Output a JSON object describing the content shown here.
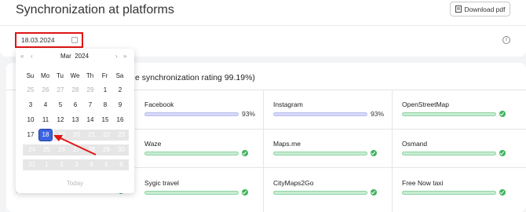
{
  "header": {
    "title": "Synchronization at platforms",
    "download_label": "Download pdf",
    "date_value": "18.03.2024"
  },
  "main": {
    "heading": "e synchronization rating 99.19%)"
  },
  "platforms": [
    {
      "name": "Facebook",
      "value": 93,
      "label": "93%",
      "color": "blue"
    },
    {
      "name": "Instagram",
      "value": 93,
      "label": "93%",
      "color": "blue"
    },
    {
      "name": "OpenStreetMap",
      "value": 100,
      "label": "",
      "color": "green"
    },
    {
      "name": "Waze",
      "value": 100,
      "label": "",
      "color": "green"
    },
    {
      "name": "Maps.me",
      "value": 100,
      "label": "",
      "color": "green"
    },
    {
      "name": "Osmand",
      "value": 100,
      "label": "",
      "color": "green"
    },
    {
      "name": "Sygic travel",
      "value": 100,
      "label": "",
      "color": "green"
    },
    {
      "name": "CityMaps2Go",
      "value": 100,
      "label": "",
      "color": "green"
    },
    {
      "name": "Free Now taxi",
      "value": 100,
      "label": "",
      "color": "green"
    }
  ],
  "calendar": {
    "month": "Mar",
    "year": "2024",
    "nav_prev_year": "«",
    "nav_prev": "‹",
    "nav_next": "›",
    "nav_next_year": "»",
    "weekdays": [
      "Su",
      "Mo",
      "Tu",
      "We",
      "Th",
      "Fr",
      "Sa"
    ],
    "weeks": [
      [
        "25",
        "26",
        "27",
        "28",
        "29",
        "1",
        "2"
      ],
      [
        "3",
        "4",
        "5",
        "6",
        "7",
        "8",
        "9"
      ],
      [
        "10",
        "11",
        "12",
        "13",
        "14",
        "15",
        "16"
      ],
      [
        "17",
        "18",
        "19",
        "20",
        "21",
        "22",
        "23"
      ],
      [
        "24",
        "25",
        "26",
        "27",
        "28",
        "29",
        "30"
      ],
      [
        "31",
        "1",
        "2",
        "3",
        "4",
        "5",
        "6"
      ]
    ],
    "selected": "18",
    "today_label": "Today"
  },
  "colors": {
    "highlight": "#e01515",
    "selected_day": "#3b63e0",
    "ok": "#3fb35f"
  }
}
